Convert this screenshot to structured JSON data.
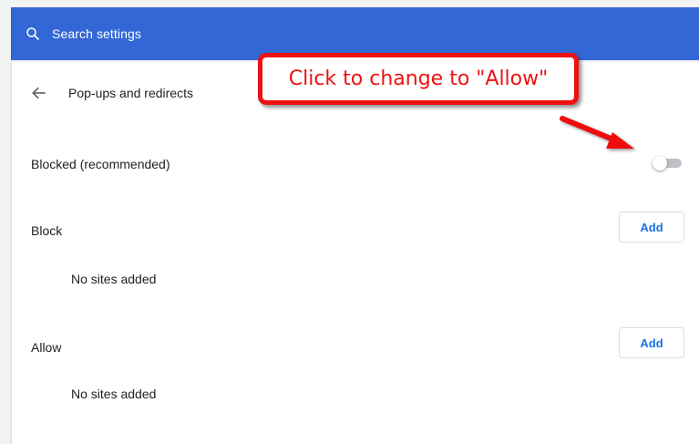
{
  "search": {
    "placeholder": "Search settings"
  },
  "page": {
    "title": "Pop-ups and redirects"
  },
  "main_setting": {
    "label": "Blocked (recommended)",
    "toggle_on": false
  },
  "block_section": {
    "title": "Block",
    "add_label": "Add",
    "empty_text": "No sites added"
  },
  "allow_section": {
    "title": "Allow",
    "add_label": "Add",
    "empty_text": "No sites added"
  },
  "annotation": {
    "text": "Click to change to \"Allow\""
  },
  "colors": {
    "header_blue": "#3367d6",
    "accent_blue": "#1a73e8",
    "annotation_red": "#ee1111",
    "toggle_off_track": "#bdc1c6"
  },
  "icons": {
    "search": "search-icon",
    "back": "back-arrow-icon"
  }
}
